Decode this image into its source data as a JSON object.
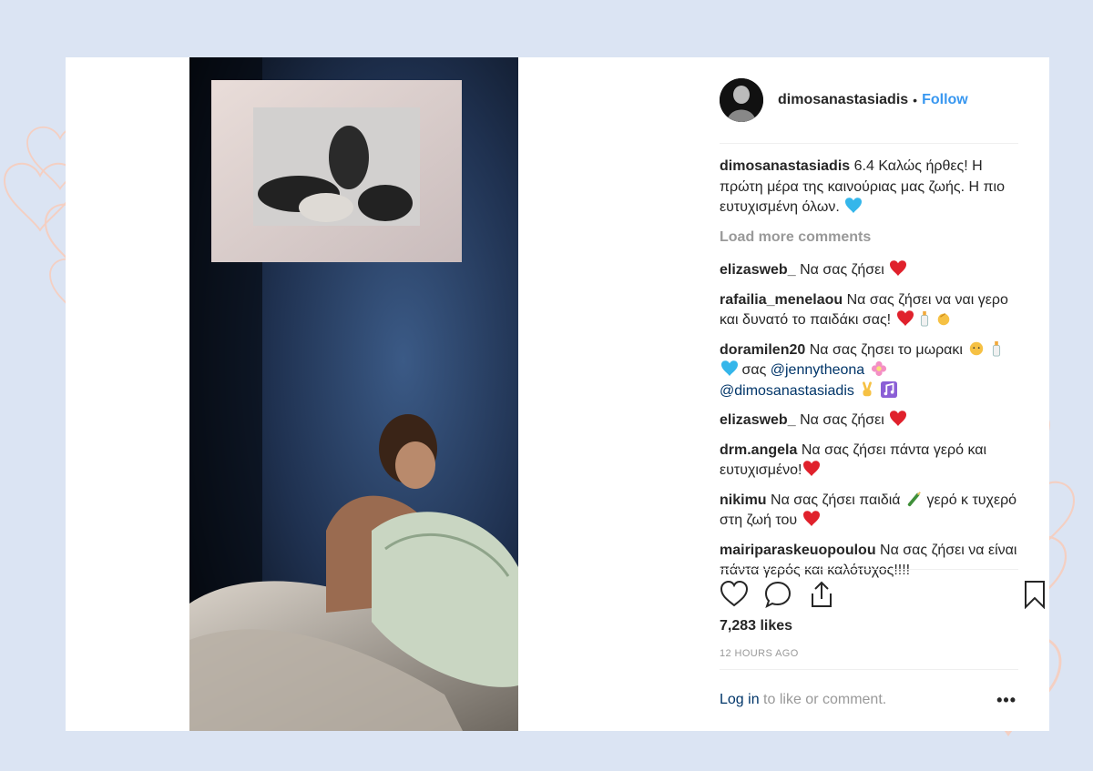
{
  "post": {
    "username": "dimosanastasiadis",
    "dot": "•",
    "follow_label": "Follow",
    "caption": {
      "username": "dimosanastasiadis",
      "text": "6.4 Καλώς ήρθες! Η πρώτη μέρα της καινούριας μας ζωής. Η πιο ευτυχισμένη όλων."
    },
    "load_more_label": "Load more comments",
    "comments": [
      {
        "username": "elizasweb_",
        "text": "Να σας ζήσει"
      },
      {
        "username": "rafailia_menelaou",
        "text": "Να σας ζήσει να ναι γερο και δυνατό το παιδάκι σας!"
      },
      {
        "username": "doramilen20",
        "text": "Να σας ζησει το μωρακι",
        "text2": "σας",
        "mention1": "@jennytheona",
        "mention2": "@dimosanastasiadis"
      },
      {
        "username": "elizasweb_",
        "text": "Να σας ζήσει"
      },
      {
        "username": "drm.angela",
        "text": "Να σας ζήσει πάντα γερό και ευτυχισμένο!"
      },
      {
        "username": "nikimu",
        "text": "Να σας ζήσει παιδιά",
        "text2": "γερό κ τυχερό στη ζωή του"
      },
      {
        "username": "mairiparaskeuopoulou",
        "text": "Να σας ζήσει να είναι πάντα γερός και καλότυχος!!!!"
      }
    ],
    "likes": "7,283 likes",
    "time": "12 HOURS AGO",
    "footer": {
      "login_label": "Log in",
      "rest": "to like or comment."
    },
    "more_label": "•••",
    "icons": [
      "heart-icon",
      "comment-icon",
      "share-icon",
      "bookmark-icon"
    ]
  },
  "colors": {
    "background": "#dbe4f3",
    "follow": "#3897f0",
    "mention": "#003569",
    "muted": "#999999",
    "heart_outline": "#f6d3c7"
  }
}
